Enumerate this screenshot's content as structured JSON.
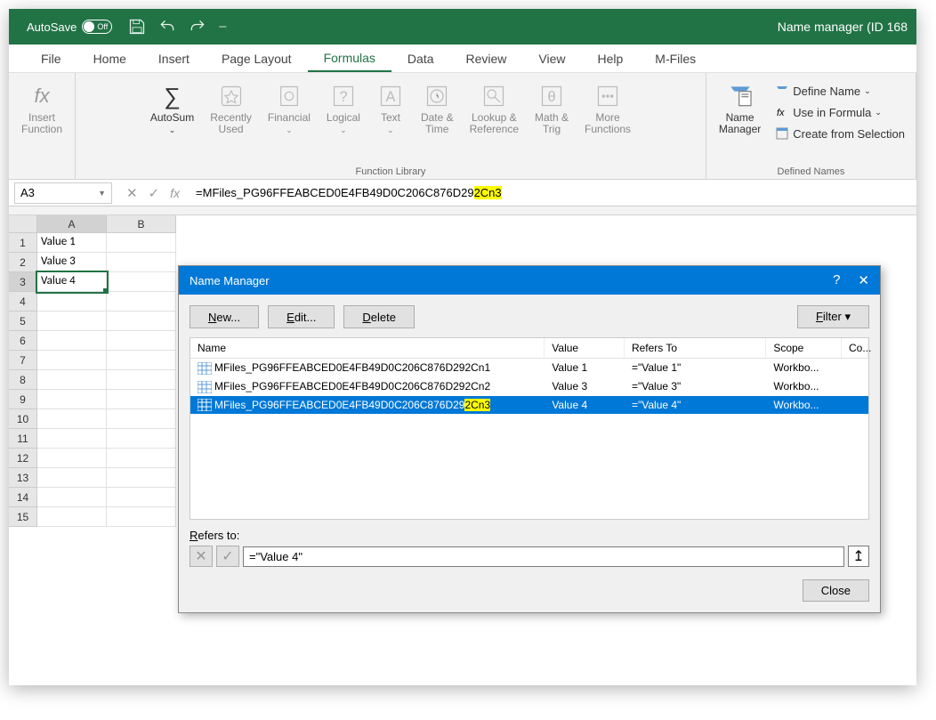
{
  "titlebar": {
    "autosave": "AutoSave",
    "autosave_state": "Off",
    "doc_title": "Name manager (ID 168"
  },
  "tabs": [
    "File",
    "Home",
    "Insert",
    "Page Layout",
    "Formulas",
    "Data",
    "Review",
    "View",
    "Help",
    "M-Files"
  ],
  "ribbon": {
    "insert_function": "Insert\nFunction",
    "autosum": "AutoSum",
    "recently_used": "Recently\nUsed",
    "financial": "Financial",
    "logical": "Logical",
    "text": "Text",
    "date_time": "Date &\nTime",
    "lookup_ref": "Lookup &\nReference",
    "math_trig": "Math &\nTrig",
    "more_fns": "More\nFunctions",
    "group_fn_lib": "Function Library",
    "name_mgr": "Name\nManager",
    "define_name": "Define Name",
    "use_in_formula": "Use in Formula",
    "create_from_sel": "Create from Selection",
    "group_defined": "Defined Names"
  },
  "name_box": "A3",
  "formula_prefix": "=MFiles_PG96FFEABCED0E4FB49D0C206C876D29",
  "formula_hl": "2Cn3",
  "columns": [
    "A",
    "B"
  ],
  "rows": [
    1,
    2,
    3,
    4,
    5,
    6,
    7,
    8,
    9,
    10,
    11,
    12,
    13,
    14,
    15
  ],
  "cells": {
    "A1": "Value 1",
    "A2": "Value 3",
    "A3": "Value 4"
  },
  "selected_cell": "A3",
  "dialog": {
    "title": "Name Manager",
    "new": "New...",
    "edit": "Edit...",
    "delete": "Delete",
    "filter": "Filter",
    "cols": {
      "name": "Name",
      "value": "Value",
      "refers": "Refers To",
      "scope": "Scope",
      "comment": "Co..."
    },
    "rows": [
      {
        "name_pre": "MFiles_PG96FFEABCED0E4FB49D0C206C876D292Cn1",
        "name_hl": "",
        "value": "Value 1",
        "refers": "=\"Value 1\"",
        "scope": "Workbo...",
        "selected": false
      },
      {
        "name_pre": "MFiles_PG96FFEABCED0E4FB49D0C206C876D292Cn2",
        "name_hl": "",
        "value": "Value 3",
        "refers": "=\"Value 3\"",
        "scope": "Workbo...",
        "selected": false
      },
      {
        "name_pre": "MFiles_PG96FFEABCED0E4FB49D0C206C876D29",
        "name_hl": "2Cn3",
        "value": "Value 4",
        "refers": "=\"Value 4\"",
        "scope": "Workbo...",
        "selected": true
      }
    ],
    "refers_to_label": "Refers to:",
    "refers_to_value": "=\"Value 4\"",
    "close": "Close"
  }
}
